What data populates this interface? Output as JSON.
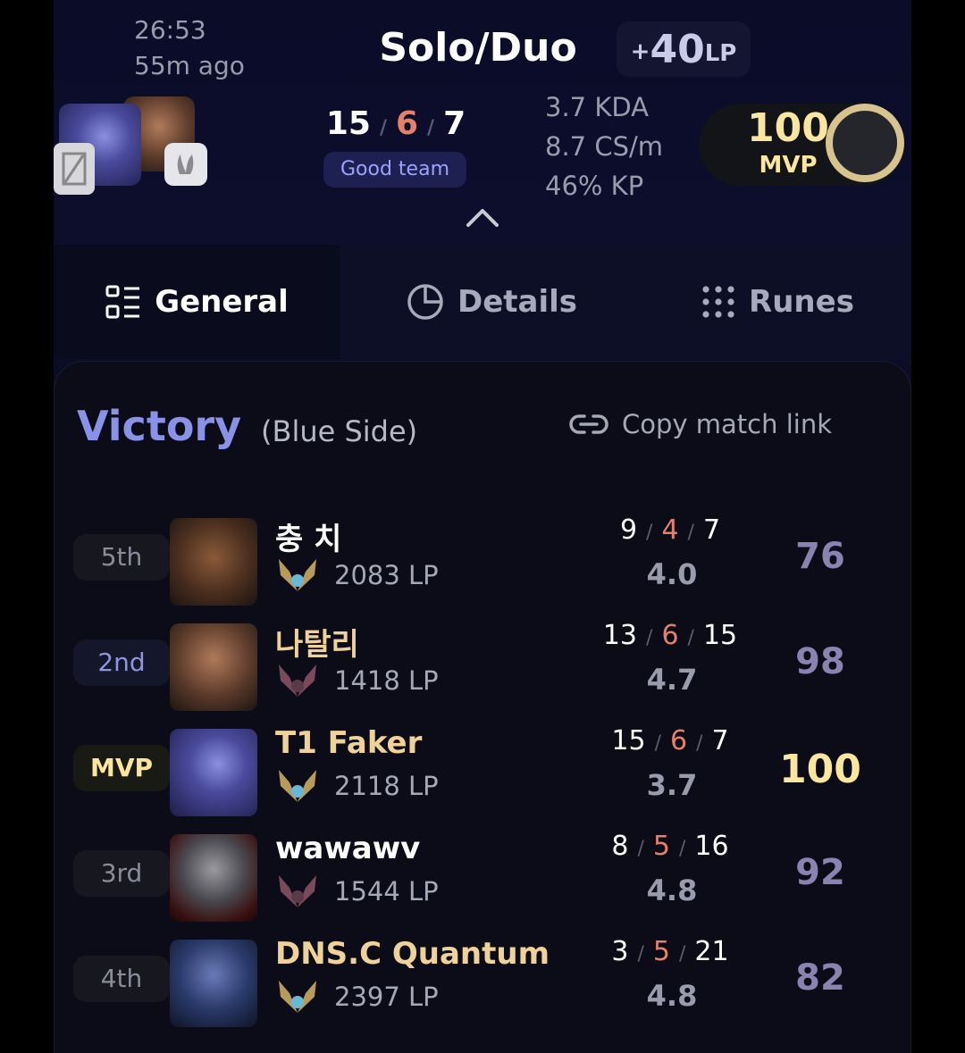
{
  "header": {
    "duration": "26:53",
    "ago": "55m ago",
    "queue": "Solo/Duo",
    "lp_plus": "+",
    "lp_value": "40",
    "lp_unit": "LP",
    "kills": "15",
    "deaths": "6",
    "assists": "7",
    "badge": "Good team",
    "kda_ratio": "3.7 KDA",
    "cs": "8.7 CS/m",
    "kp": "46% KP",
    "score": "100",
    "score_label": "MVP"
  },
  "tabs": [
    {
      "label": "General",
      "icon": "list-icon"
    },
    {
      "label": "Details",
      "icon": "pie-chart-icon"
    },
    {
      "label": "Runes",
      "icon": "grid-dots-icon"
    }
  ],
  "result": {
    "title": "Victory",
    "side": "(Blue Side)",
    "copy_link": "Copy match link"
  },
  "players": [
    {
      "rank": "5th",
      "name": "충 치",
      "lp": "2083 LP",
      "k": "9",
      "d": "4",
      "a": "7",
      "ratio": "4.0",
      "score": "76"
    },
    {
      "rank": "2nd",
      "name": "나탈리",
      "lp": "1418 LP",
      "k": "13",
      "d": "6",
      "a": "15",
      "ratio": "4.7",
      "score": "98"
    },
    {
      "rank": "MVP",
      "name": "T1 Faker",
      "lp": "2118 LP",
      "k": "15",
      "d": "6",
      "a": "7",
      "ratio": "3.7",
      "score": "100"
    },
    {
      "rank": "3rd",
      "name": "wawawv",
      "lp": "1544 LP",
      "k": "8",
      "d": "5",
      "a": "16",
      "ratio": "4.8",
      "score": "92"
    },
    {
      "rank": "4th",
      "name": "DNS.C Quantum",
      "lp": "2397 LP",
      "k": "3",
      "d": "5",
      "a": "21",
      "ratio": "4.8",
      "score": "82"
    }
  ],
  "colors": {
    "accent_gold": "#fbe6a0",
    "victory_blue": "#8a92e8",
    "death_red": "#e5806a"
  }
}
